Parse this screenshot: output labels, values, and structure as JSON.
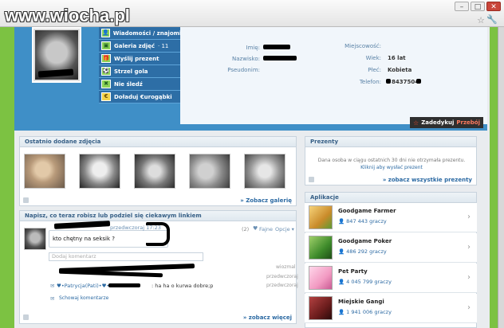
{
  "watermark": "www.wiocha.pl",
  "window": {
    "minimize": "–",
    "maximize": "□",
    "close": "✕"
  },
  "icons": {
    "star": "☆",
    "wrench": "🔧",
    "chevron": "›",
    "heart": "♥",
    "comment": "✉"
  },
  "profile": {
    "actions": [
      {
        "label": "Wiadomości / znajomi",
        "icon": "👤"
      },
      {
        "label": "Galeria zdjęć",
        "count": "· 11",
        "icon": "▣"
      },
      {
        "label": "Wyślij prezent",
        "icon": "🎁"
      },
      {
        "label": "Strzel gola",
        "icon": "⚽"
      },
      {
        "label": "Nie śledź",
        "icon": "✖"
      },
      {
        "label": "Doładuj €urogąbki",
        "icon": "€"
      }
    ],
    "fields": {
      "imie_label": "Imię:",
      "nazwisko_label": "Nazwisko:",
      "pseudonim_label": "Pseudonim:",
      "miejscowosc_label": "Miejscowość:",
      "wiek_label": "Wiek:",
      "wiek_value": "16 lat",
      "plec_label": "Płeć:",
      "plec_value": "Kobieta",
      "telefon_label": "Telefon:",
      "telefon_value": "8437504"
    },
    "dedykuj_a": "Zadedykuj",
    "dedykuj_b": "Przebój"
  },
  "photos": {
    "title": "Ostatnio dodane zdjęcia",
    "more": "» Zobacz galerię"
  },
  "status": {
    "title": "Napisz, co teraz robisz lub podziel się ciekawym linkiem",
    "time": "przedwczoraj 17:23",
    "comments": "(2)",
    "like": "Fajne",
    "options": "Opcje ▾",
    "post": "kto chętny na seksik ?",
    "comment_placeholder": "Dodaj komentarz",
    "reply1_like": "wiozmal",
    "reply1_time": "przedwczoraj",
    "reply2_author": "♥•Patrycja(Pati)•♥•",
    "reply2_text": ": ha ha o kurwa dobre;p",
    "reply2_time": "przedwczoraj",
    "hide": "Schowaj komentarze",
    "more": "» zobacz więcej"
  },
  "presents": {
    "title": "Prezenty",
    "text1": "Dana osoba w ciągu ostatnich 30 dni nie otrzymała prezentu.",
    "text2": "Kliknij aby wysłać prezent",
    "more": "» zobacz wszystkie prezenty"
  },
  "apps": {
    "title": "Aplikacje",
    "items": [
      {
        "name": "Goodgame Farmer",
        "users": "847 443 graczy",
        "color": "#e6b44a"
      },
      {
        "name": "Goodgame Poker",
        "users": "486 292 graczy",
        "color": "#5aa33c"
      },
      {
        "name": "Pet Party",
        "users": "4 045 799 graczy",
        "color": "#f2a5c6"
      },
      {
        "name": "Miejskie Gangi",
        "users": "1 941 006 graczy",
        "color": "#7a1f1f"
      }
    ]
  }
}
